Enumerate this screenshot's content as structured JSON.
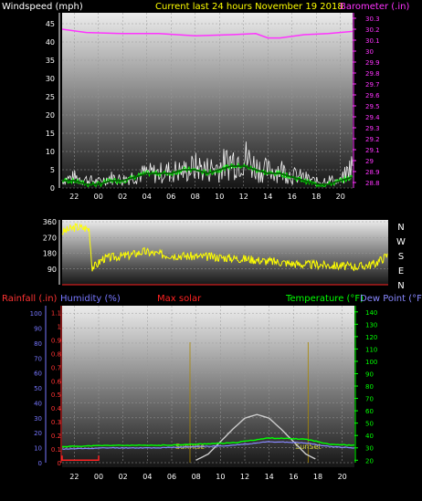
{
  "header": {
    "windspeed_label": "Windspeed (mph)",
    "title": "Current last 24 hours November 19 2018",
    "barometer_label": "Barometer (.in)"
  },
  "colors": {
    "windspeed": "#ffffff",
    "title": "#ffff00",
    "barometer": "#ff33ff",
    "gust": "#f0f0f0",
    "wind_avg": "#00ee00",
    "wind_dir": "#ffff00",
    "rainfall": "#ff3333",
    "humidity": "#7777ff",
    "max_solar": "#ff2222",
    "temperature": "#00ff00",
    "dewpoint": "#8888ff",
    "solar_curve": "#cccccc",
    "sunrise": "#cccc33"
  },
  "chart_data": [
    {
      "type": "line",
      "x_tick_labels": [
        "22",
        "00",
        "02",
        "04",
        "06",
        "08",
        "10",
        "12",
        "14",
        "16",
        "18",
        "20"
      ],
      "xlim": [
        21,
        45
      ],
      "left_axis": {
        "label": "Windspeed (mph)",
        "ticks": [
          "0",
          "5",
          "10",
          "15",
          "20",
          "25",
          "30",
          "35",
          "40",
          "45"
        ],
        "ylim": [
          0,
          48
        ]
      },
      "right_axis": {
        "label": "Barometer (.in)",
        "ticks": [
          "28.8",
          "28.9",
          "29",
          "29.1",
          "29.2",
          "29.3",
          "29.4",
          "29.5",
          "29.6",
          "29.7",
          "29.8",
          "29.9",
          "30",
          "30.1",
          "30.2",
          "30.3"
        ],
        "ylim": [
          28.75,
          30.35
        ]
      },
      "series": [
        {
          "role": "barometer",
          "axis": "right",
          "x": [
            21,
            23,
            26,
            29,
            32,
            35,
            37,
            38,
            39,
            41,
            43,
            45
          ],
          "y": [
            30.2,
            30.17,
            30.16,
            30.16,
            30.14,
            30.15,
            30.16,
            30.12,
            30.12,
            30.15,
            30.16,
            30.18
          ]
        },
        {
          "role": "gust",
          "axis": "left",
          "x": [
            21,
            22,
            23,
            24,
            25,
            26,
            27,
            28,
            29,
            30,
            31,
            32,
            33,
            34,
            35,
            36,
            37,
            38,
            39,
            40,
            41,
            42,
            43,
            44,
            45
          ],
          "y": [
            4,
            5,
            4,
            3,
            5,
            4,
            6,
            7,
            7,
            8,
            8,
            10,
            9,
            10,
            13,
            15,
            10,
            8,
            9,
            6,
            5,
            3,
            4,
            3,
            11
          ]
        },
        {
          "role": "wind_avg",
          "axis": "left",
          "x": [
            21,
            22,
            23,
            24,
            25,
            26,
            27,
            28,
            29,
            30,
            31,
            32,
            33,
            34,
            35,
            36,
            37,
            38,
            39,
            40,
            41,
            42,
            43,
            44,
            45
          ],
          "y": [
            2,
            2,
            1,
            1,
            2,
            2,
            3,
            4,
            4,
            4,
            5,
            5,
            4,
            5,
            6,
            6,
            5,
            4,
            4,
            3,
            2,
            1,
            1,
            2,
            3
          ]
        }
      ]
    },
    {
      "type": "line",
      "x_tick_labels": [],
      "xlim": [
        21,
        45
      ],
      "left_axis": {
        "ticks": [
          "90",
          "180",
          "270",
          "360"
        ],
        "ylim": [
          0,
          360
        ]
      },
      "right_labels": [
        "N",
        "W",
        "S",
        "E",
        "N"
      ],
      "series": [
        {
          "role": "wind_direction",
          "x": [
            21,
            22,
            23,
            23.2,
            23.5,
            24,
            25,
            26,
            27,
            28,
            29,
            30,
            31,
            32,
            33,
            34,
            35,
            36,
            37,
            38,
            39,
            40,
            41,
            42,
            43,
            44,
            45
          ],
          "y": [
            300,
            330,
            320,
            100,
            110,
            150,
            160,
            170,
            190,
            175,
            170,
            165,
            160,
            160,
            155,
            150,
            145,
            135,
            130,
            120,
            115,
            115,
            110,
            105,
            105,
            120,
            170
          ]
        }
      ]
    },
    {
      "type": "line",
      "x_tick_labels": [
        "22",
        "00",
        "02",
        "04",
        "06",
        "08",
        "10",
        "12",
        "14",
        "16",
        "18",
        "20"
      ],
      "xlim": [
        21,
        45
      ],
      "left_axis_outer": {
        "label": "Rainfall (.in)",
        "ticks": [
          "0",
          "0.1",
          "0.2",
          "0.3",
          "0.4",
          "0.5",
          "0.6",
          "0.7",
          "0.8",
          "0.9",
          "1",
          "1.1"
        ],
        "ylim": [
          0,
          1.15
        ]
      },
      "left_axis_inner": {
        "label": "Humidity (%)",
        "ticks": [
          "0",
          "10",
          "20",
          "30",
          "40",
          "50",
          "60",
          "70",
          "80",
          "90",
          "100"
        ],
        "ylim": [
          0,
          105
        ]
      },
      "center_label": "Max solar",
      "right_axis": {
        "label": "Temperature (°F)",
        "ticks": [
          "20",
          "30",
          "40",
          "50",
          "60",
          "70",
          "80",
          "90",
          "100",
          "110",
          "120",
          "130",
          "140"
        ],
        "ylim": [
          18,
          145
        ]
      },
      "right_label_2": "Dew Point (°F)",
      "annotations": [
        {
          "text": "SunRise",
          "x": 31.5
        },
        {
          "text": "SunSet",
          "x": 41.2
        }
      ],
      "series": [
        {
          "role": "max_solar",
          "x": [
            21,
            21,
            24,
            24
          ],
          "y": [
            5,
            0,
            0,
            5
          ]
        },
        {
          "role": "temperature",
          "axis": "right",
          "x": [
            21,
            25,
            29,
            32,
            35,
            38,
            41,
            43,
            45
          ],
          "y": [
            31,
            32,
            32,
            33,
            34,
            38,
            37,
            33,
            32
          ]
        },
        {
          "role": "dewpoint",
          "axis": "right",
          "x": [
            21,
            25,
            29,
            32,
            35,
            38,
            41,
            43,
            45
          ],
          "y": [
            29,
            30,
            30,
            31,
            32,
            35,
            34,
            31,
            30
          ]
        },
        {
          "role": "solar_curve",
          "axis": "right",
          "x": [
            32,
            33,
            34,
            35,
            36,
            37,
            38,
            39,
            40,
            41,
            42
          ],
          "y": [
            20,
            25,
            35,
            45,
            54,
            57,
            54,
            45,
            35,
            25,
            20
          ]
        }
      ]
    }
  ]
}
